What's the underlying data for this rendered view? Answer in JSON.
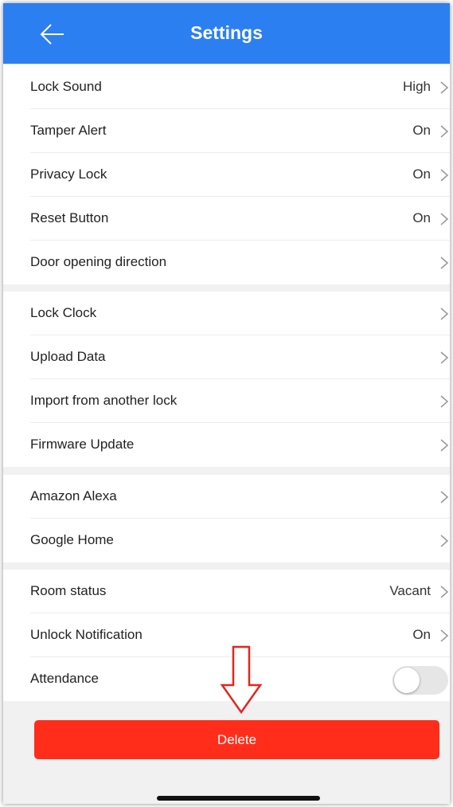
{
  "header": {
    "title": "Settings",
    "back_icon": "arrow-left-icon"
  },
  "group1": [
    {
      "label": "Lock Sound",
      "value": "High"
    },
    {
      "label": "Tamper Alert",
      "value": "On"
    },
    {
      "label": "Privacy Lock",
      "value": "On"
    },
    {
      "label": "Reset Button",
      "value": "On"
    },
    {
      "label": "Door opening direction",
      "value": ""
    }
  ],
  "group2": [
    {
      "label": "Lock Clock"
    },
    {
      "label": "Upload Data"
    },
    {
      "label": "Import from another lock"
    },
    {
      "label": "Firmware Update"
    }
  ],
  "group3": [
    {
      "label": "Amazon Alexa"
    },
    {
      "label": "Google Home"
    }
  ],
  "group4": [
    {
      "label": "Room status",
      "value": "Vacant"
    },
    {
      "label": "Unlock Notification",
      "value": "On"
    },
    {
      "label": "Attendance",
      "toggle_on": false
    }
  ],
  "delete_label": "Delete",
  "colors": {
    "header": "#2c7ff0",
    "delete": "#ff2d1a",
    "annotation_arrow": "#e3261c"
  }
}
